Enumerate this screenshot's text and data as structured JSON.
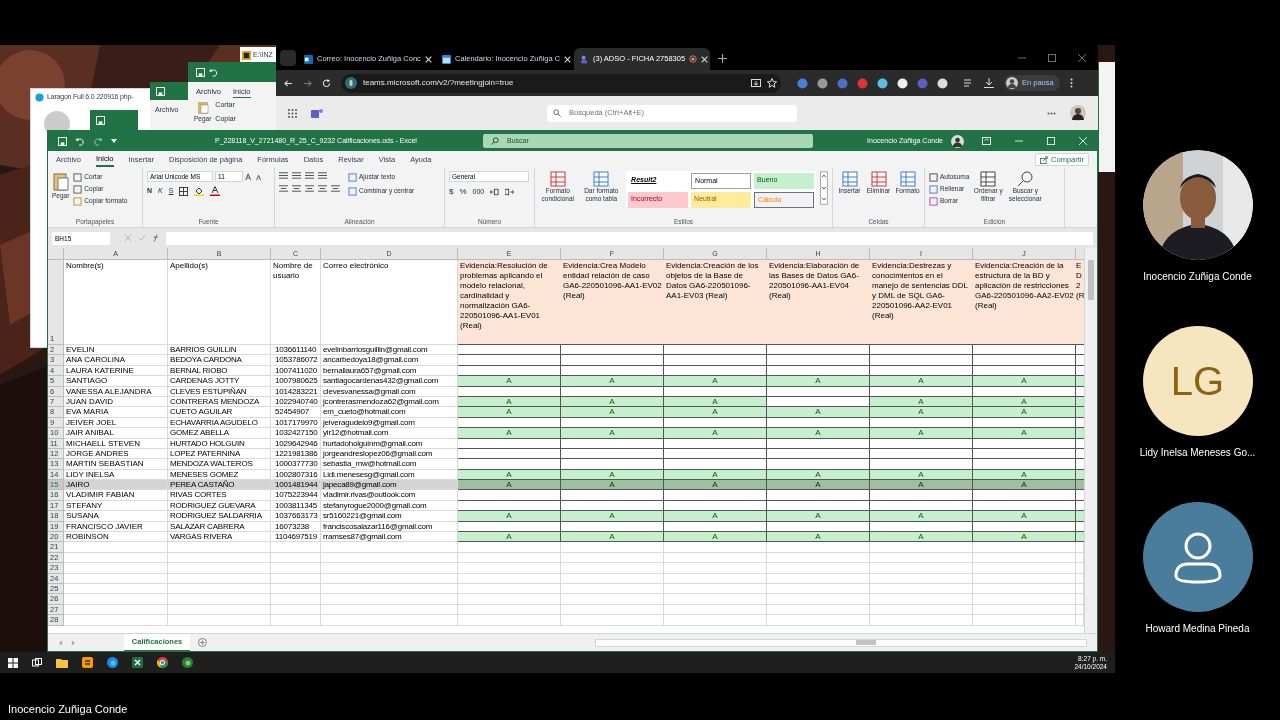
{
  "behind": {
    "laragon_title": "Laragon Full 6.0 220916 php-",
    "explorer_title": "E:\\INZ",
    "excel_back": {
      "tab": "Archivo"
    },
    "excel_front": {
      "tabs": [
        "Archivo",
        "Inicio"
      ],
      "cut": "Cortar",
      "copy": "Copiar",
      "paste": "Pegar"
    }
  },
  "browser": {
    "tabs": [
      {
        "title": "Correo: Inocencio Zuñiga Conc",
        "selected": false
      },
      {
        "title": "Calendario: Inocencio Zuñiga C",
        "selected": false
      },
      {
        "title": "(3) ADSO - FICHA 2758305",
        "selected": true
      }
    ],
    "url": "teams.microsoft.com/v2/?meetingjoin=true",
    "profile": "En pausa",
    "search_placeholder": "Búsqueda (Ctrl+Alt+E)"
  },
  "excel": {
    "title": "P_228118_V_2721480_R_25_C_9232 Calificaciones.ods - Excel",
    "search": "Buscar",
    "user": "Inocencio Zúñiga Conde",
    "menu": [
      {
        "label": "Archivo",
        "selected": false
      },
      {
        "label": "Inicio",
        "selected": true
      },
      {
        "label": "Insertar",
        "selected": false
      },
      {
        "label": "Disposición de página",
        "selected": false
      },
      {
        "label": "Fórmulas",
        "selected": false
      },
      {
        "label": "Datos",
        "selected": false
      },
      {
        "label": "Revisar",
        "selected": false
      },
      {
        "label": "Vista",
        "selected": false
      },
      {
        "label": "Ayuda",
        "selected": false
      }
    ],
    "share": "Compartir",
    "ribbon": {
      "clipboard": {
        "paste": "Pegar",
        "cut": "Cortar",
        "copy": "Copiar",
        "format_painter": "Copiar formato",
        "label": "Portapapeles"
      },
      "font": {
        "name": "Arial Unicode MS",
        "size": "11",
        "bold": "N",
        "italic": "K",
        "underline": "S",
        "label": "Fuente"
      },
      "alignment": {
        "wrap": "Ajustar texto",
        "merge": "Combinar y centrar",
        "label": "Alineación"
      },
      "number": {
        "format": "General",
        "currency": "$",
        "percent": "%",
        "thousands": "000",
        "label": "Número"
      },
      "styles": {
        "conditional": "Formato condicional",
        "as_table": "Dar formato como tabla",
        "label": "Estilos",
        "cells": [
          {
            "label": "Result2",
            "kind": "result"
          },
          {
            "label": "Normal",
            "kind": "normal"
          },
          {
            "label": "Bueno",
            "kind": "good"
          },
          {
            "label": "Incorrecto",
            "kind": "bad"
          },
          {
            "label": "Neutral",
            "kind": "neutral"
          },
          {
            "label": "Cálculo",
            "kind": "calc"
          }
        ]
      },
      "cells": {
        "insert": "Insertar",
        "delete": "Eliminar",
        "format": "Formato",
        "label": "Celdas"
      },
      "editing": {
        "autosum": "Autosuma",
        "fill": "Rellenar",
        "clear": "Borrar",
        "sort": "Ordenar y filtrar",
        "find": "Buscar y seleccionar",
        "label": "Edición"
      }
    },
    "name_box": "BH15",
    "columns": [
      "A",
      "B",
      "C",
      "D",
      "E",
      "F",
      "G",
      "H",
      "I",
      "J"
    ],
    "header_row": {
      "n": "1",
      "fields": [
        "Nombre(s)",
        "Apellido(s)",
        "Nombre de usuario",
        "Correo electrónico"
      ],
      "evidences": [
        "Evidencia:Resolución de problemas aplicando el modelo relacional, cardinalidad y normalización GA6-220501096-AA1-EV01 (Real)",
        "Evidencia:Crea Modelo entidad relación de caso GA6-220501096-AA1-EV02 (Real)",
        "Evidencia:Creación de los objetos de la Base de Datos GA6-220501096-AA1-EV03 (Real)",
        "Evidencia:Elaboración de las Bases de Datos GA6-220501096-AA1-EV04 (Real)",
        "Evidencia:Destrezas y conocimientos en el manejo de sentencias DDL y DML de SQL GA6-220501096-AA2-EV01 (Real)",
        "Evidencia:Creación de la estructura de la BD y aplicación de restricciones GA6-220501096-AA2-EV02 (Real)"
      ],
      "cut_column": "E D 2 (R"
    },
    "rows": [
      {
        "n": "2",
        "first": "EVELIN",
        "last": "BARRIOS GUILLIN",
        "user": "1036611140",
        "email": "evelinbarriosguillin@gmail.com",
        "grades": [
          {
            "filled": false
          },
          {
            "filled": false
          },
          {
            "filled": false
          },
          {
            "filled": false
          },
          {
            "filled": false
          },
          {
            "filled": false
          }
        ],
        "selected": false
      },
      {
        "n": "3",
        "first": "ANA CAROLINA",
        "last": "BEDOYA CARDONA",
        "user": "1053786072",
        "email": "ancarbedoya18@gmail.com",
        "grades": [
          {
            "filled": false
          },
          {
            "filled": false
          },
          {
            "filled": false
          },
          {
            "filled": false
          },
          {
            "filled": false
          },
          {
            "filled": false
          }
        ],
        "selected": false
      },
      {
        "n": "4",
        "first": "LAURA KATERINE",
        "last": "BERNAL RIOBO",
        "user": "1007411020",
        "email": "bernallaura657@gmail.com",
        "grades": [
          {
            "filled": false
          },
          {
            "filled": false
          },
          {
            "filled": false
          },
          {
            "filled": false
          },
          {
            "filled": false
          },
          {
            "filled": false
          }
        ],
        "selected": false
      },
      {
        "n": "5",
        "first": "SANTIAGO",
        "last": "CARDENAS JOTTY",
        "user": "1007980625",
        "email": "santiagocardenas432@gmail.com",
        "grades": [
          {
            "filled": true,
            "text": "A"
          },
          {
            "filled": true,
            "text": "A"
          },
          {
            "filled": true,
            "text": "A"
          },
          {
            "filled": true,
            "text": "A"
          },
          {
            "filled": true,
            "text": "A"
          },
          {
            "filled": true,
            "text": "A"
          }
        ],
        "selected": false
      },
      {
        "n": "6",
        "first": "VANESSA ALEJANDRA",
        "last": "CLEVES ESTUPIÑAN",
        "user": "1014283221",
        "email": "clevesvanessa@gmail.com",
        "grades": [
          {
            "filled": false
          },
          {
            "filled": false
          },
          {
            "filled": false
          },
          {
            "filled": false
          },
          {
            "filled": false
          },
          {
            "filled": false
          }
        ],
        "selected": false
      },
      {
        "n": "7",
        "first": "JUAN DAVID",
        "last": "CONTRERAS MENDOZA",
        "user": "1022940740",
        "email": "jcontrerasmendoza62@gmail.com",
        "grades": [
          {
            "filled": true,
            "text": "A"
          },
          {
            "filled": true,
            "text": "A"
          },
          {
            "filled": true,
            "text": "A"
          },
          {
            "filled": false
          },
          {
            "filled": true,
            "text": "A"
          },
          {
            "filled": true,
            "text": "A"
          }
        ],
        "selected": false
      },
      {
        "n": "8",
        "first": "EVA MARIA",
        "last": "CUETO AGUILAR",
        "user": "52454907",
        "email": "em_cueto@hotmail.com",
        "grades": [
          {
            "filled": true,
            "text": "A"
          },
          {
            "filled": true,
            "text": "A"
          },
          {
            "filled": true,
            "text": "A"
          },
          {
            "filled": true,
            "text": "A"
          },
          {
            "filled": true,
            "text": "A"
          },
          {
            "filled": true,
            "text": "A"
          }
        ],
        "selected": false
      },
      {
        "n": "9",
        "first": "JEIVER JOEL",
        "last": "ECHAVARRIA AGUDELO",
        "user": "1017179970",
        "email": "jeiveragudelo9@gmail.com",
        "grades": [
          {
            "filled": false
          },
          {
            "filled": false
          },
          {
            "filled": false
          },
          {
            "filled": false
          },
          {
            "filled": false
          },
          {
            "filled": false
          }
        ],
        "selected": false
      },
      {
        "n": "10",
        "first": "JAIR ANIBAL",
        "last": "GOMEZ ABELLA",
        "user": "1032427150",
        "email": "yir12@hotmail.com",
        "grades": [
          {
            "filled": true,
            "text": "A"
          },
          {
            "filled": true,
            "text": "A"
          },
          {
            "filled": true,
            "text": "A"
          },
          {
            "filled": true,
            "text": "A"
          },
          {
            "filled": true,
            "text": "A"
          },
          {
            "filled": true,
            "text": "A"
          }
        ],
        "selected": false
      },
      {
        "n": "11",
        "first": "MICHAELL STEVEN",
        "last": "HURTADO HOLGUIN",
        "user": "1029642946",
        "email": "hurtadoholguinm@gmail.com",
        "grades": [
          {
            "filled": false
          },
          {
            "filled": false
          },
          {
            "filled": false
          },
          {
            "filled": false
          },
          {
            "filled": false
          },
          {
            "filled": false
          }
        ],
        "selected": false
      },
      {
        "n": "12",
        "first": "JORGE ANDRES",
        "last": "LOPEZ PATERNINA",
        "user": "1221981386",
        "email": "jorgeandreslopez06@gmail.com",
        "grades": [
          {
            "filled": false
          },
          {
            "filled": false
          },
          {
            "filled": false
          },
          {
            "filled": false
          },
          {
            "filled": false
          },
          {
            "filled": false
          }
        ],
        "selected": false
      },
      {
        "n": "13",
        "first": "MARTIN SEBASTIAN",
        "last": "MENDOZA WALTEROS",
        "user": "1000377730",
        "email": "sebastia_mw@hotmail.com",
        "grades": [
          {
            "filled": false
          },
          {
            "filled": false
          },
          {
            "filled": false
          },
          {
            "filled": false
          },
          {
            "filled": false
          },
          {
            "filled": false
          }
        ],
        "selected": false
      },
      {
        "n": "14",
        "first": "LIDY INELSA",
        "last": "MENESES GOMEZ",
        "user": "1002807316",
        "email": "Lidi.menesesg@gmail.com",
        "grades": [
          {
            "filled": true,
            "text": "A"
          },
          {
            "filled": true,
            "text": "A"
          },
          {
            "filled": true,
            "text": "A"
          },
          {
            "filled": true,
            "text": "A"
          },
          {
            "filled": true,
            "text": "A"
          },
          {
            "filled": true,
            "text": "A"
          }
        ],
        "selected": false
      },
      {
        "n": "15",
        "first": "JAIRO",
        "last": "PEREA CASTAÑO",
        "user": "1001481944",
        "email": "japeca89@gmail.com",
        "grades": [
          {
            "filled": true,
            "text": "A"
          },
          {
            "filled": true,
            "text": "A"
          },
          {
            "filled": true,
            "text": "A"
          },
          {
            "filled": true,
            "text": "A"
          },
          {
            "filled": true,
            "text": "A"
          },
          {
            "filled": true,
            "text": "A"
          }
        ],
        "selected": true
      },
      {
        "n": "16",
        "first": "VLADIMIR FABIAN",
        "last": "RIVAS CORTES",
        "user": "1075223944",
        "email": "vladimir.rivas@outlook.com",
        "grades": [
          {
            "filled": false
          },
          {
            "filled": false
          },
          {
            "filled": false
          },
          {
            "filled": false
          },
          {
            "filled": false
          },
          {
            "filled": false
          }
        ],
        "selected": false
      },
      {
        "n": "17",
        "first": "STEFANY",
        "last": "RODRIGUEZ GUEVARA",
        "user": "1003811345",
        "email": "stefanyrogue2000@gmail.com",
        "grades": [
          {
            "filled": false
          },
          {
            "filled": false
          },
          {
            "filled": false
          },
          {
            "filled": false
          },
          {
            "filled": false
          },
          {
            "filled": false
          }
        ],
        "selected": false
      },
      {
        "n": "18",
        "first": "SUSANA",
        "last": "RODRIGUEZ SALDARRIA",
        "user": "1037663173",
        "email": "sr5160221@gmail.com",
        "grades": [
          {
            "filled": true,
            "text": "A"
          },
          {
            "filled": true,
            "text": "A"
          },
          {
            "filled": true,
            "text": "A"
          },
          {
            "filled": true,
            "text": "A"
          },
          {
            "filled": true,
            "text": "A"
          },
          {
            "filled": true,
            "text": "A"
          }
        ],
        "selected": false
      },
      {
        "n": "19",
        "first": "FRANCISCO JAVIER",
        "last": "SALAZAR CABRERA",
        "user": "16073238",
        "email": "franciscosalazar116@gmail.com",
        "grades": [
          {
            "filled": false
          },
          {
            "filled": false
          },
          {
            "filled": false
          },
          {
            "filled": false
          },
          {
            "filled": false
          },
          {
            "filled": false
          }
        ],
        "selected": false
      },
      {
        "n": "20",
        "first": "ROBINSON",
        "last": "VARGAS RIVERA",
        "user": "1104697519",
        "email": "rramses87@gmail.com",
        "grades": [
          {
            "filled": true,
            "text": "A"
          },
          {
            "filled": true,
            "text": "A"
          },
          {
            "filled": true,
            "text": "A"
          },
          {
            "filled": true,
            "text": "A"
          },
          {
            "filled": true,
            "text": "A"
          },
          {
            "filled": true,
            "text": "A"
          }
        ],
        "selected": false
      }
    ],
    "empty_rows": [
      "21",
      "22",
      "23",
      "24",
      "25",
      "26",
      "27",
      "28"
    ],
    "sheets": [
      {
        "label": "Calificaciones",
        "selected": true
      }
    ]
  },
  "taskbar": {
    "time": "8:27 p. m.",
    "date": "24/10/2024"
  },
  "participants": [
    {
      "name": "Inocencio Zuñiga Conde",
      "kind": "video"
    },
    {
      "name": "Lidy Inelsa Meneses Go...",
      "kind": "initials",
      "initials": "LG"
    },
    {
      "name": "Howard Medina Pineda",
      "kind": "avatar"
    }
  ],
  "presenter": "Inocencio Zuñiga Conde"
}
